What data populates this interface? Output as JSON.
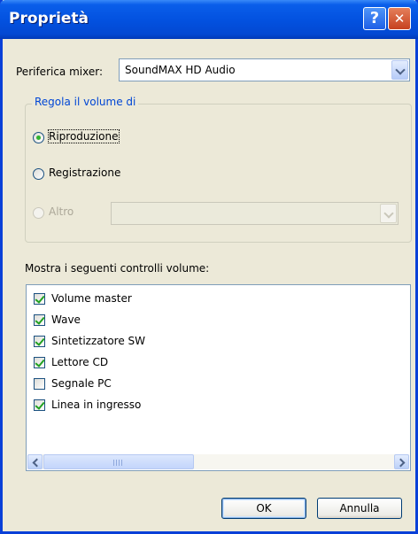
{
  "window": {
    "title": "Proprietà",
    "help_glyph": "?",
    "close_glyph": "✕"
  },
  "mixer": {
    "label": "Periferica mixer:",
    "selected": "SoundMAX HD Audio"
  },
  "volume_group": {
    "legend": "Regola il volume di",
    "options": [
      {
        "label": "Riproduzione",
        "checked": true,
        "enabled": true
      },
      {
        "label": "Registrazione",
        "checked": false,
        "enabled": true
      },
      {
        "label": "Altro",
        "checked": false,
        "enabled": false
      }
    ],
    "altro_combo_value": ""
  },
  "controls": {
    "label": "Mostra i seguenti controlli volume:",
    "items": [
      {
        "label": "Volume master",
        "checked": true
      },
      {
        "label": "Wave",
        "checked": true
      },
      {
        "label": "Sintetizzatore SW",
        "checked": true
      },
      {
        "label": "Lettore CD",
        "checked": true
      },
      {
        "label": "Segnale PC",
        "checked": false
      },
      {
        "label": "Linea in ingresso",
        "checked": true
      }
    ]
  },
  "buttons": {
    "ok": "OK",
    "cancel": "Annulla"
  },
  "colors": {
    "titlebar": "#0352E0",
    "dialog_bg": "#ECE9D8",
    "group_legend": "#0046D5",
    "check_green": "#21A121"
  }
}
